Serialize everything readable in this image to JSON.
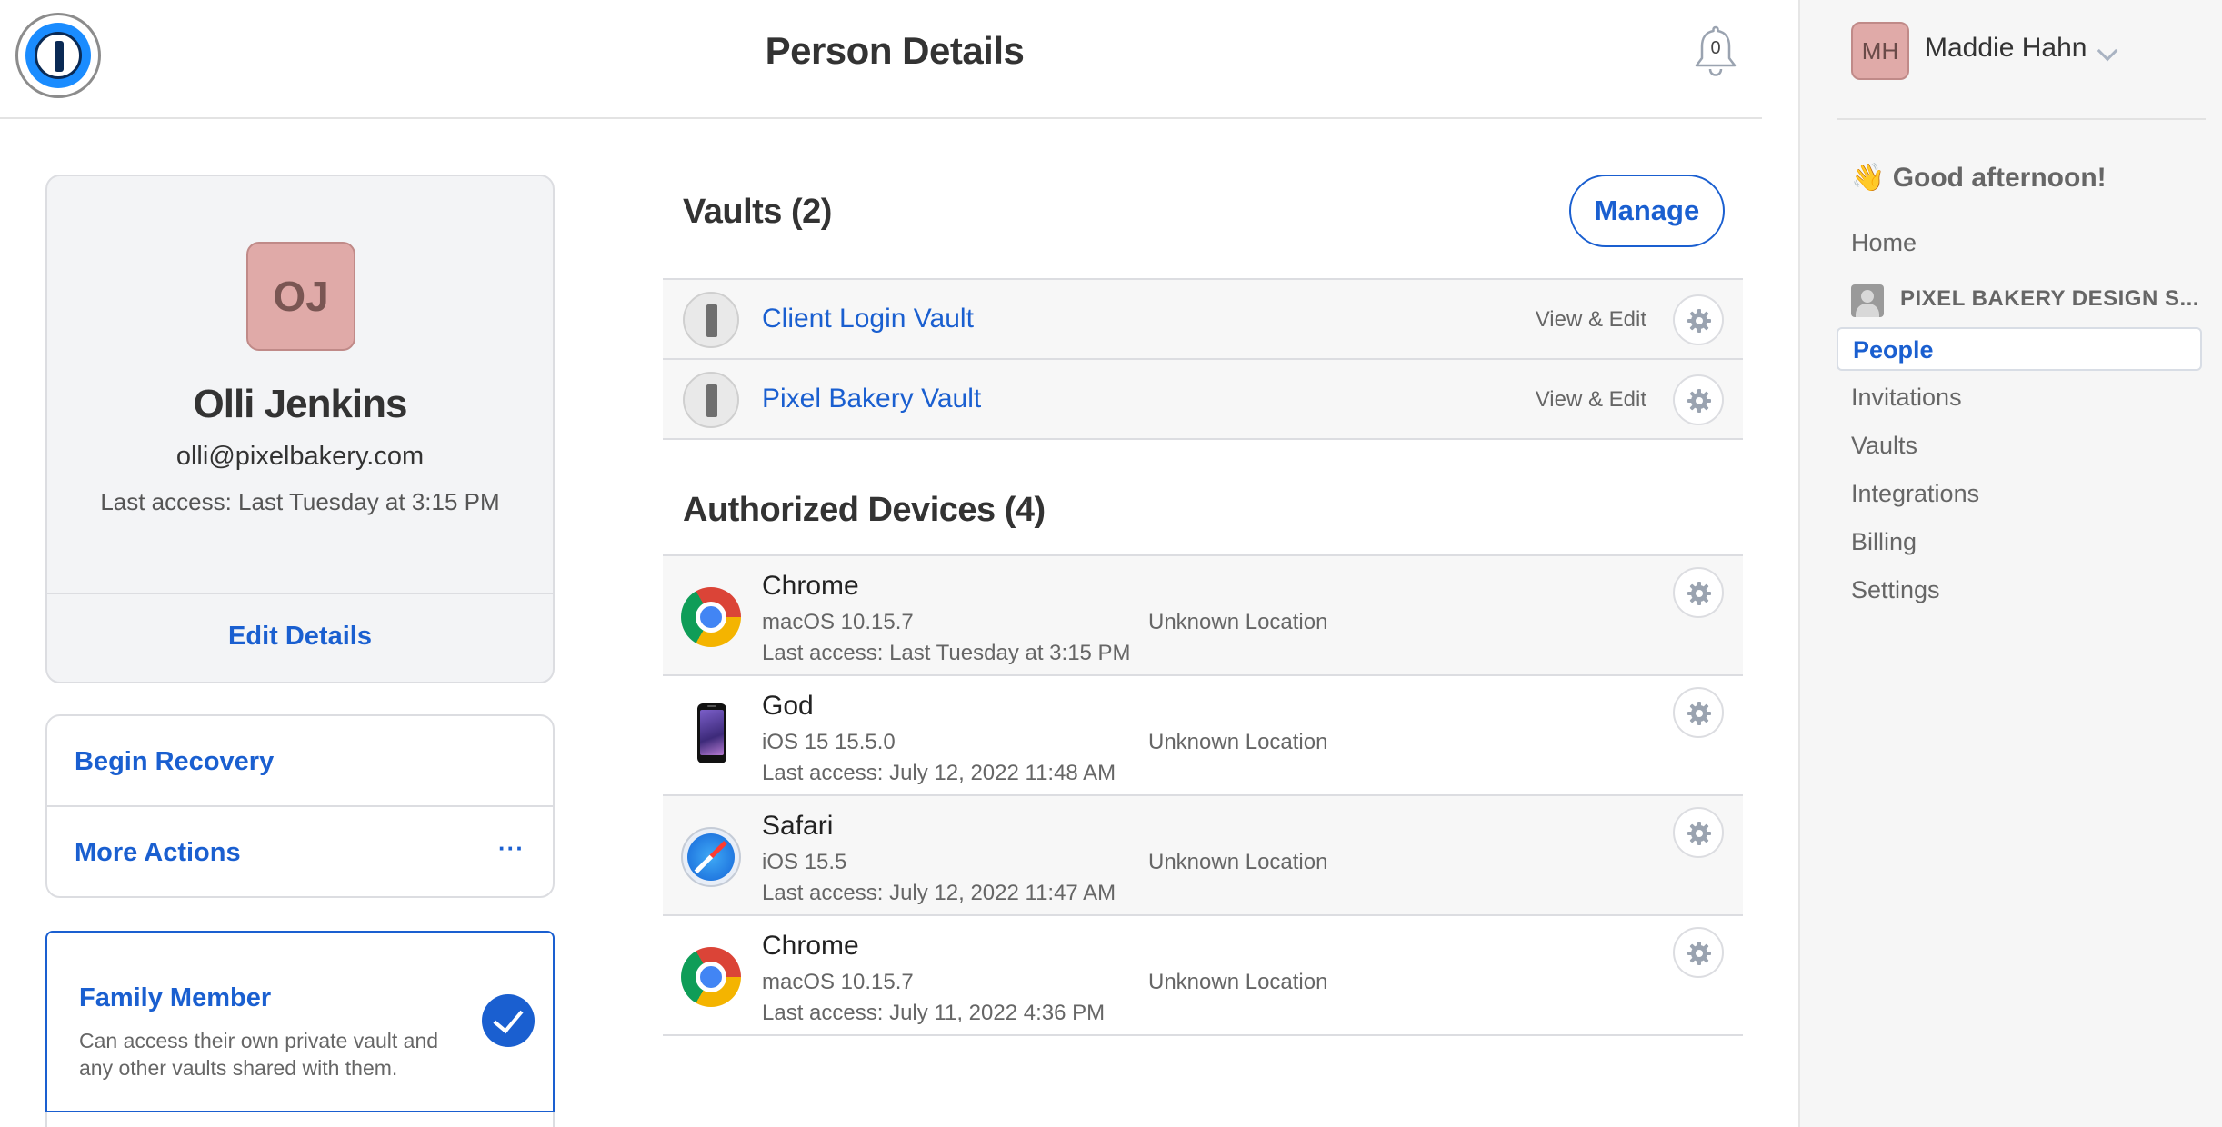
{
  "header": {
    "title": "Person Details",
    "notification_count": "0"
  },
  "sidebar": {
    "user_initials": "MH",
    "user_name": "Maddie Hahn",
    "greeting": "👋 Good afternoon!",
    "items": [
      {
        "label": "Home"
      },
      {
        "label": "PIXEL BAKERY DESIGN S..."
      },
      {
        "label": "People",
        "active": true
      },
      {
        "label": "Invitations"
      },
      {
        "label": "Vaults"
      },
      {
        "label": "Integrations"
      },
      {
        "label": "Billing"
      },
      {
        "label": "Settings"
      }
    ]
  },
  "person": {
    "initials": "OJ",
    "name": "Olli Jenkins",
    "email": "olli@pixelbakery.com",
    "last_access": "Last access: Last Tuesday at 3:15 PM",
    "edit_label": "Edit Details"
  },
  "actions": {
    "begin_recovery": "Begin Recovery",
    "more_actions": "More Actions",
    "more_icon": "···"
  },
  "family": {
    "title": "Family Member",
    "description": "Can access their own private vault and any other vaults shared with them."
  },
  "vaults": {
    "heading": "Vaults (2)",
    "manage_label": "Manage",
    "rows": [
      {
        "name": "Client Login Vault",
        "permission": "View & Edit"
      },
      {
        "name": "Pixel Bakery Vault",
        "permission": "View & Edit"
      }
    ]
  },
  "devices": {
    "heading": "Authorized Devices (4)",
    "rows": [
      {
        "icon": "chrome-icon",
        "name": "Chrome",
        "os": "macOS 10.15.7",
        "last_access": "Last access: Last Tuesday at 3:15 PM",
        "location": "Unknown Location"
      },
      {
        "icon": "iphone-icon",
        "name": "God",
        "os": "iOS 15 15.5.0",
        "last_access": "Last access: July 12, 2022 11:48 AM",
        "location": "Unknown Location"
      },
      {
        "icon": "safari-icon",
        "name": "Safari",
        "os": "iOS 15.5",
        "last_access": "Last access: July 12, 2022 11:47 AM",
        "location": "Unknown Location"
      },
      {
        "icon": "chrome-icon",
        "name": "Chrome",
        "os": "macOS 10.15.7",
        "last_access": "Last access: July 11, 2022 4:36 PM",
        "location": "Unknown Location"
      }
    ]
  },
  "colors": {
    "accent": "#1a5fd0",
    "avatar": "#e0aaa8",
    "sidebar_bg": "#f6f6f6"
  }
}
